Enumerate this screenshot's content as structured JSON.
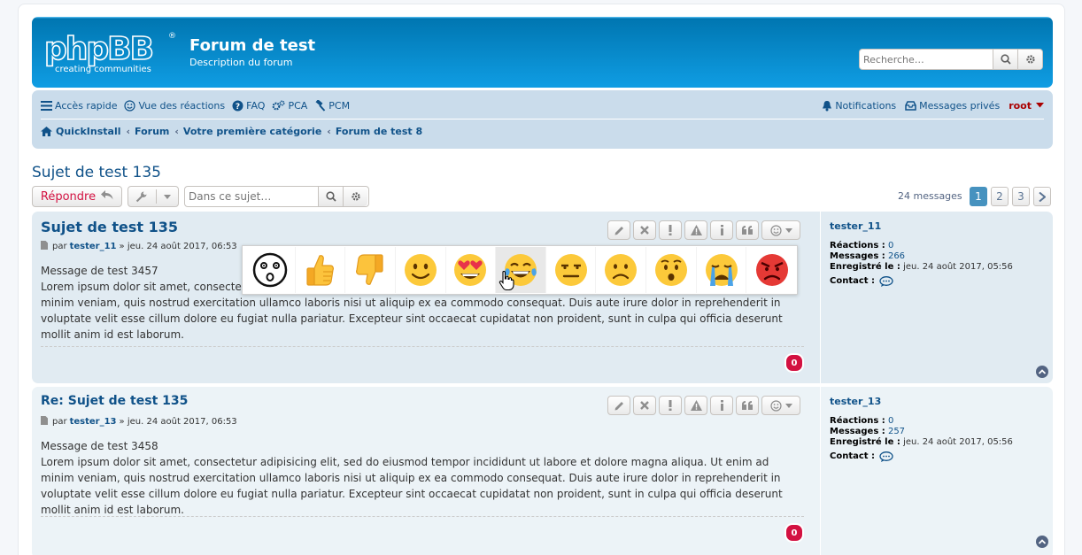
{
  "header": {
    "logo_text": "phpBB",
    "logo_tagline": "creating communities",
    "site_title": "Forum de test",
    "site_description": "Description du forum",
    "search_placeholder": "Recherche…"
  },
  "navbar": {
    "quick_access": "Accès rapide",
    "reactions_view": "Vue des réactions",
    "faq": "FAQ",
    "pca": "PCA",
    "pcm": "PCM",
    "notifications": "Notifications",
    "private_messages": "Messages privés",
    "username": "root",
    "breadcrumbs": [
      "QuickInstall",
      "Forum",
      "Votre première catégorie",
      "Forum de test 8"
    ]
  },
  "topic": {
    "title": "Sujet de test 135",
    "reply_label": "Répondre",
    "search_placeholder": "Dans ce sujet…",
    "message_count": "24 messages",
    "pages": [
      "1",
      "2",
      "3"
    ]
  },
  "posts": [
    {
      "title": "Sujet de test 135",
      "by": "par",
      "author": "tester_11",
      "date": "» jeu. 24 août 2017, 06:53",
      "body_line1": "Message de test 3457",
      "body": "Lorem ipsum dolor sit amet, consectetur adipisicing elit, sed do eiusmod tempor incididunt ut labore et dolore magna aliqua. Ut enim ad minim veniam, quis nostrud exercitation ullamco laboris nisi ut aliquip ex ea commodo consequat. Duis aute irure dolor in reprehenderit in voluptate velit esse cillum dolore eu fugiat nulla pariatur. Excepteur sint occaecat cupidatat non proident, sunt in culpa qui officia deserunt mollit anim id est laborum.",
      "reaction_count": "0",
      "profile": {
        "name": "tester_11",
        "reactions_label": "Réactions :",
        "reactions": "0",
        "messages_label": "Messages :",
        "messages": "266",
        "registered_label": "Enregistré le :",
        "registered": "jeu. 24 août 2017, 05:56",
        "contact_label": "Contact :"
      }
    },
    {
      "title": "Re: Sujet de test 135",
      "by": "par",
      "author": "tester_13",
      "date": "» jeu. 24 août 2017, 06:53",
      "body_line1": "Message de test 3458",
      "body": "Lorem ipsum dolor sit amet, consectetur adipisicing elit, sed do eiusmod tempor incididunt ut labore et dolore magna aliqua. Ut enim ad minim veniam, quis nostrud exercitation ullamco laboris nisi ut aliquip ex ea commodo consequat. Duis aute irure dolor in reprehenderit in voluptate velit esse cillum dolore eu fugiat nulla pariatur. Excepteur sint occaecat cupidatat non proident, sunt in culpa qui officia deserunt mollit anim id est laborum.",
      "reaction_count": "0",
      "profile": {
        "name": "tester_13",
        "reactions_label": "Réactions :",
        "reactions": "0",
        "messages_label": "Messages :",
        "messages": "257",
        "registered_label": "Enregistré le :",
        "registered": "jeu. 24 août 2017, 05:56",
        "contact_label": "Contact :"
      }
    }
  ],
  "reactions_popup": [
    "surprised-face-icon",
    "thumbs-up-icon",
    "thumbs-down-icon",
    "smiling-face-icon",
    "heart-eyes-icon",
    "tears-of-joy-icon",
    "neutral-face-icon",
    "frowning-face-icon",
    "hushed-face-icon",
    "crying-face-icon",
    "angry-face-icon"
  ],
  "colors": {
    "header_blue": "#12a3eb",
    "navbar": "#cadceb",
    "link": "#105289",
    "reply_red": "#d31141",
    "username_red": "#aa0000",
    "post_bg1": "#e1ebf2",
    "post_bg2": "#ecf3f7"
  }
}
